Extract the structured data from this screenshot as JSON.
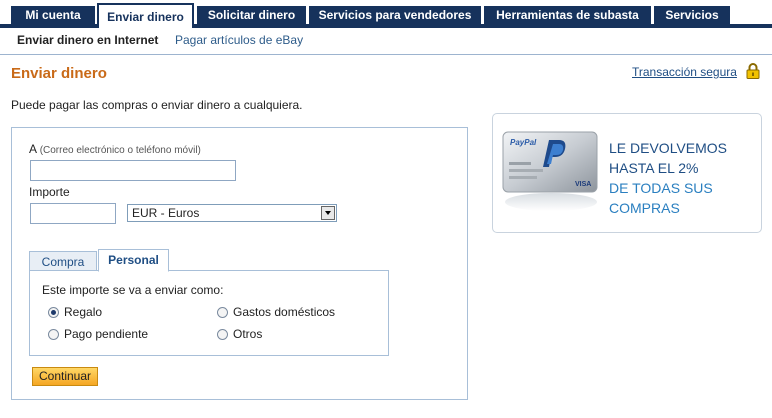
{
  "nav": {
    "tabs": [
      {
        "label": "Mi cuenta"
      },
      {
        "label": "Enviar dinero"
      },
      {
        "label": "Solicitar dinero"
      },
      {
        "label": "Servicios para vendedores"
      },
      {
        "label": "Herramientas de subasta"
      },
      {
        "label": "Servicios"
      }
    ],
    "subtabs": [
      {
        "label": "Enviar dinero en Internet"
      },
      {
        "label": "Pagar artículos de eBay"
      }
    ]
  },
  "page": {
    "title": "Enviar dinero",
    "secure_link": "Transacción segura",
    "intro": "Puede pagar las compras o enviar dinero a cualquiera."
  },
  "form": {
    "to_label": "A",
    "to_hint": "(Correo electrónico o teléfono móvil)",
    "to_value": "",
    "amount_label": "Importe",
    "amount_value": "",
    "currency": "EUR - Euros",
    "tabs": [
      "Compra",
      "Personal"
    ],
    "purpose_prompt": "Este importe se va a enviar como:",
    "options": [
      "Regalo",
      "Gastos domésticos",
      "Pago pendiente",
      "Otros"
    ],
    "selected_option": "Regalo",
    "submit": "Continuar"
  },
  "promo": {
    "card_brand": "PayPal",
    "card_network": "VISA",
    "line1": "LE DEVOLVEMOS",
    "line2": "HASTA EL 2%",
    "line3": "DE TODAS SUS",
    "line4": "COMPRAS"
  }
}
